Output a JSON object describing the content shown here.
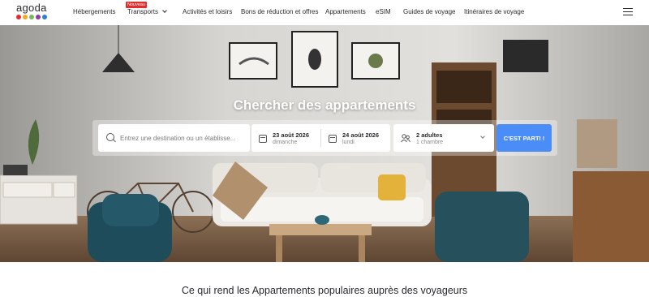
{
  "brand": {
    "logo_text": "agoda",
    "dot_colors": [
      "#e12d2d",
      "#f5a623",
      "#7ab55c",
      "#8a3fa0",
      "#2f7fd3"
    ]
  },
  "nav": {
    "items": [
      {
        "label": "Hébergements"
      },
      {
        "label": "Transports",
        "badge": "Nouveau"
      },
      {
        "label": "Activités et loisirs"
      },
      {
        "label": "Bons de réduction et offres"
      },
      {
        "label": "Appartements"
      },
      {
        "label": "eSIM"
      },
      {
        "label": "Guides de voyage"
      },
      {
        "label": "Itinéraires de voyage"
      }
    ]
  },
  "hero": {
    "title": "Chercher des appartements"
  },
  "search": {
    "destination_placeholder": "Entrez une destination ou un établisse...",
    "checkin_date": "23 août 2026",
    "checkin_day": "dimanche",
    "checkout_date": "24 août 2026",
    "checkout_day": "lundi",
    "guests_main": "2 adultes",
    "guests_sub": "1 chambre",
    "submit_label": "C'EST PARTI !",
    "accent_color": "#4b8df7"
  },
  "section": {
    "title": "Ce qui rend les Appartements populaires auprès des voyageurs"
  }
}
